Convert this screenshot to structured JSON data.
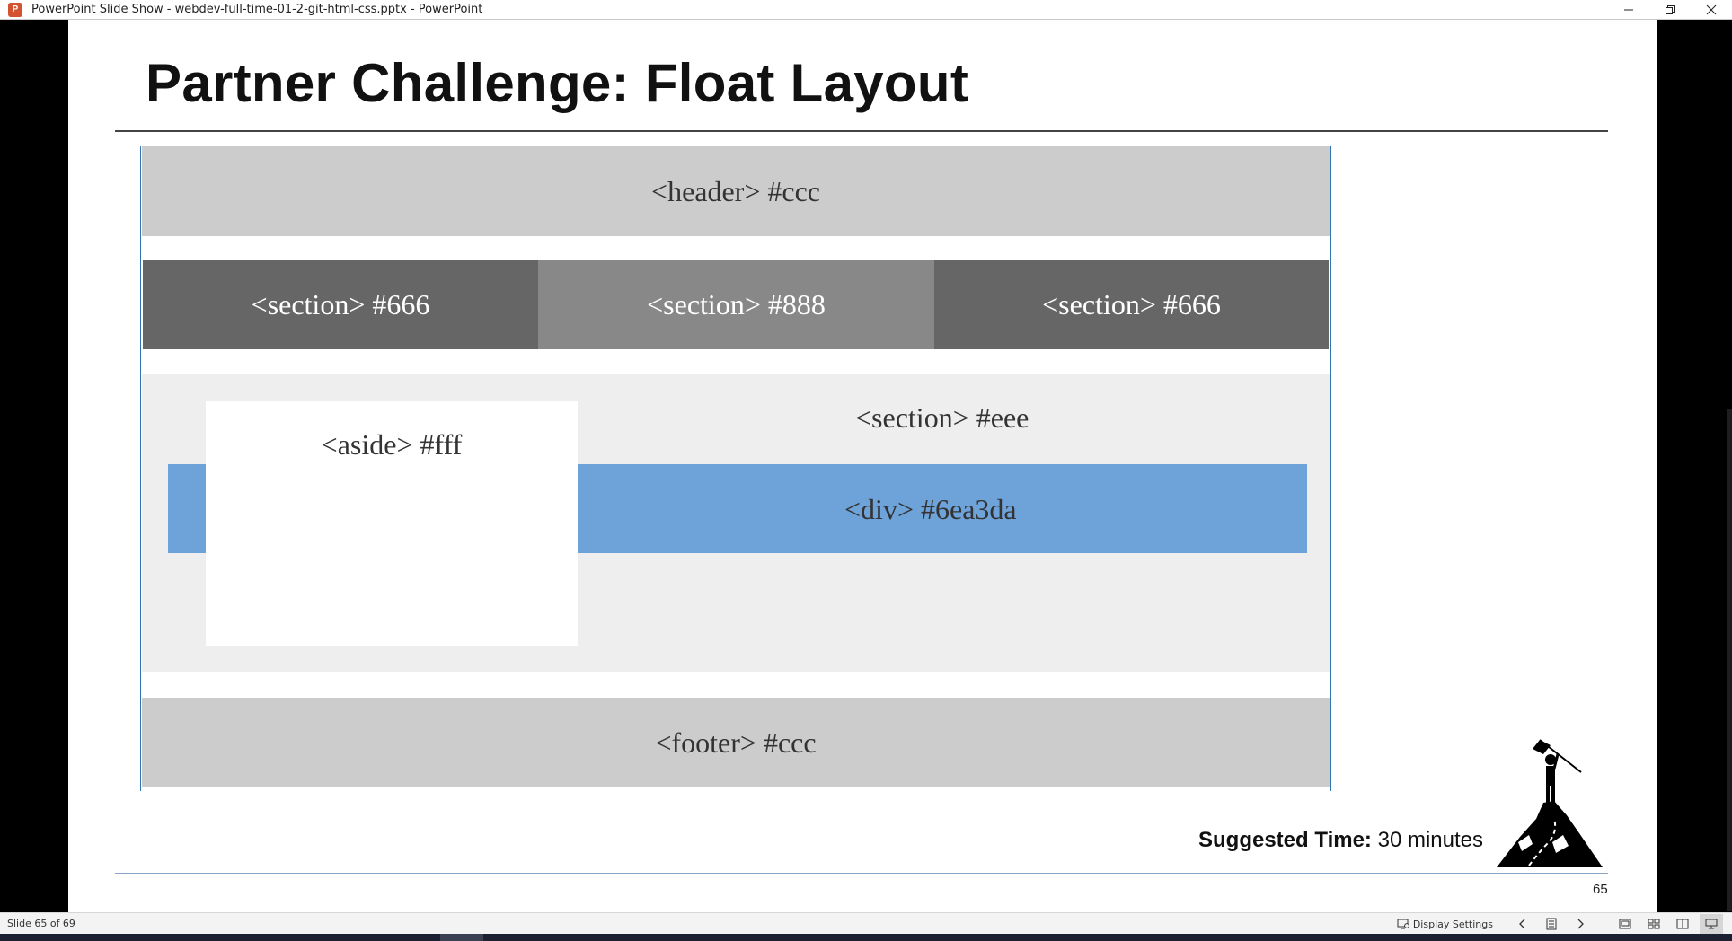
{
  "window": {
    "title": "PowerPoint Slide Show  -  webdev-full-time-01-2-git-html-css.pptx - PowerPoint",
    "app_icon_letter": "P",
    "controls": [
      "minimize-icon",
      "restore-icon",
      "close-icon"
    ]
  },
  "slide": {
    "title": "Partner Challenge: Float Layout",
    "blocks": {
      "header": "<header> #ccc",
      "section_left": "<section> #666",
      "section_middle": "<section> #888",
      "section_right": "<section> #666",
      "main_section": "<section> #eee",
      "aside": "<aside> #fff",
      "div": "<div> #6ea3da",
      "footer": "<footer> #ccc"
    },
    "suggested_time_label": "Suggested Time:",
    "suggested_time_value": "30 minutes",
    "page_number": "65",
    "colors": {
      "header": "#cccccc",
      "section_dark": "#666666",
      "section_mid": "#888888",
      "main": "#eeeeee",
      "aside": "#ffffff",
      "div": "#6ea3da",
      "footer": "#cccccc"
    },
    "icon": "climber-flag-icon"
  },
  "statusbar": {
    "slide_count": "Slide 65 of 69",
    "display_settings_label": "Display Settings",
    "icons": [
      "display-settings-icon",
      "previous-icon",
      "slide-menu-icon",
      "next-icon",
      "normal-view-icon",
      "slide-sorter-icon",
      "reading-view-icon",
      "slide-show-icon"
    ]
  }
}
